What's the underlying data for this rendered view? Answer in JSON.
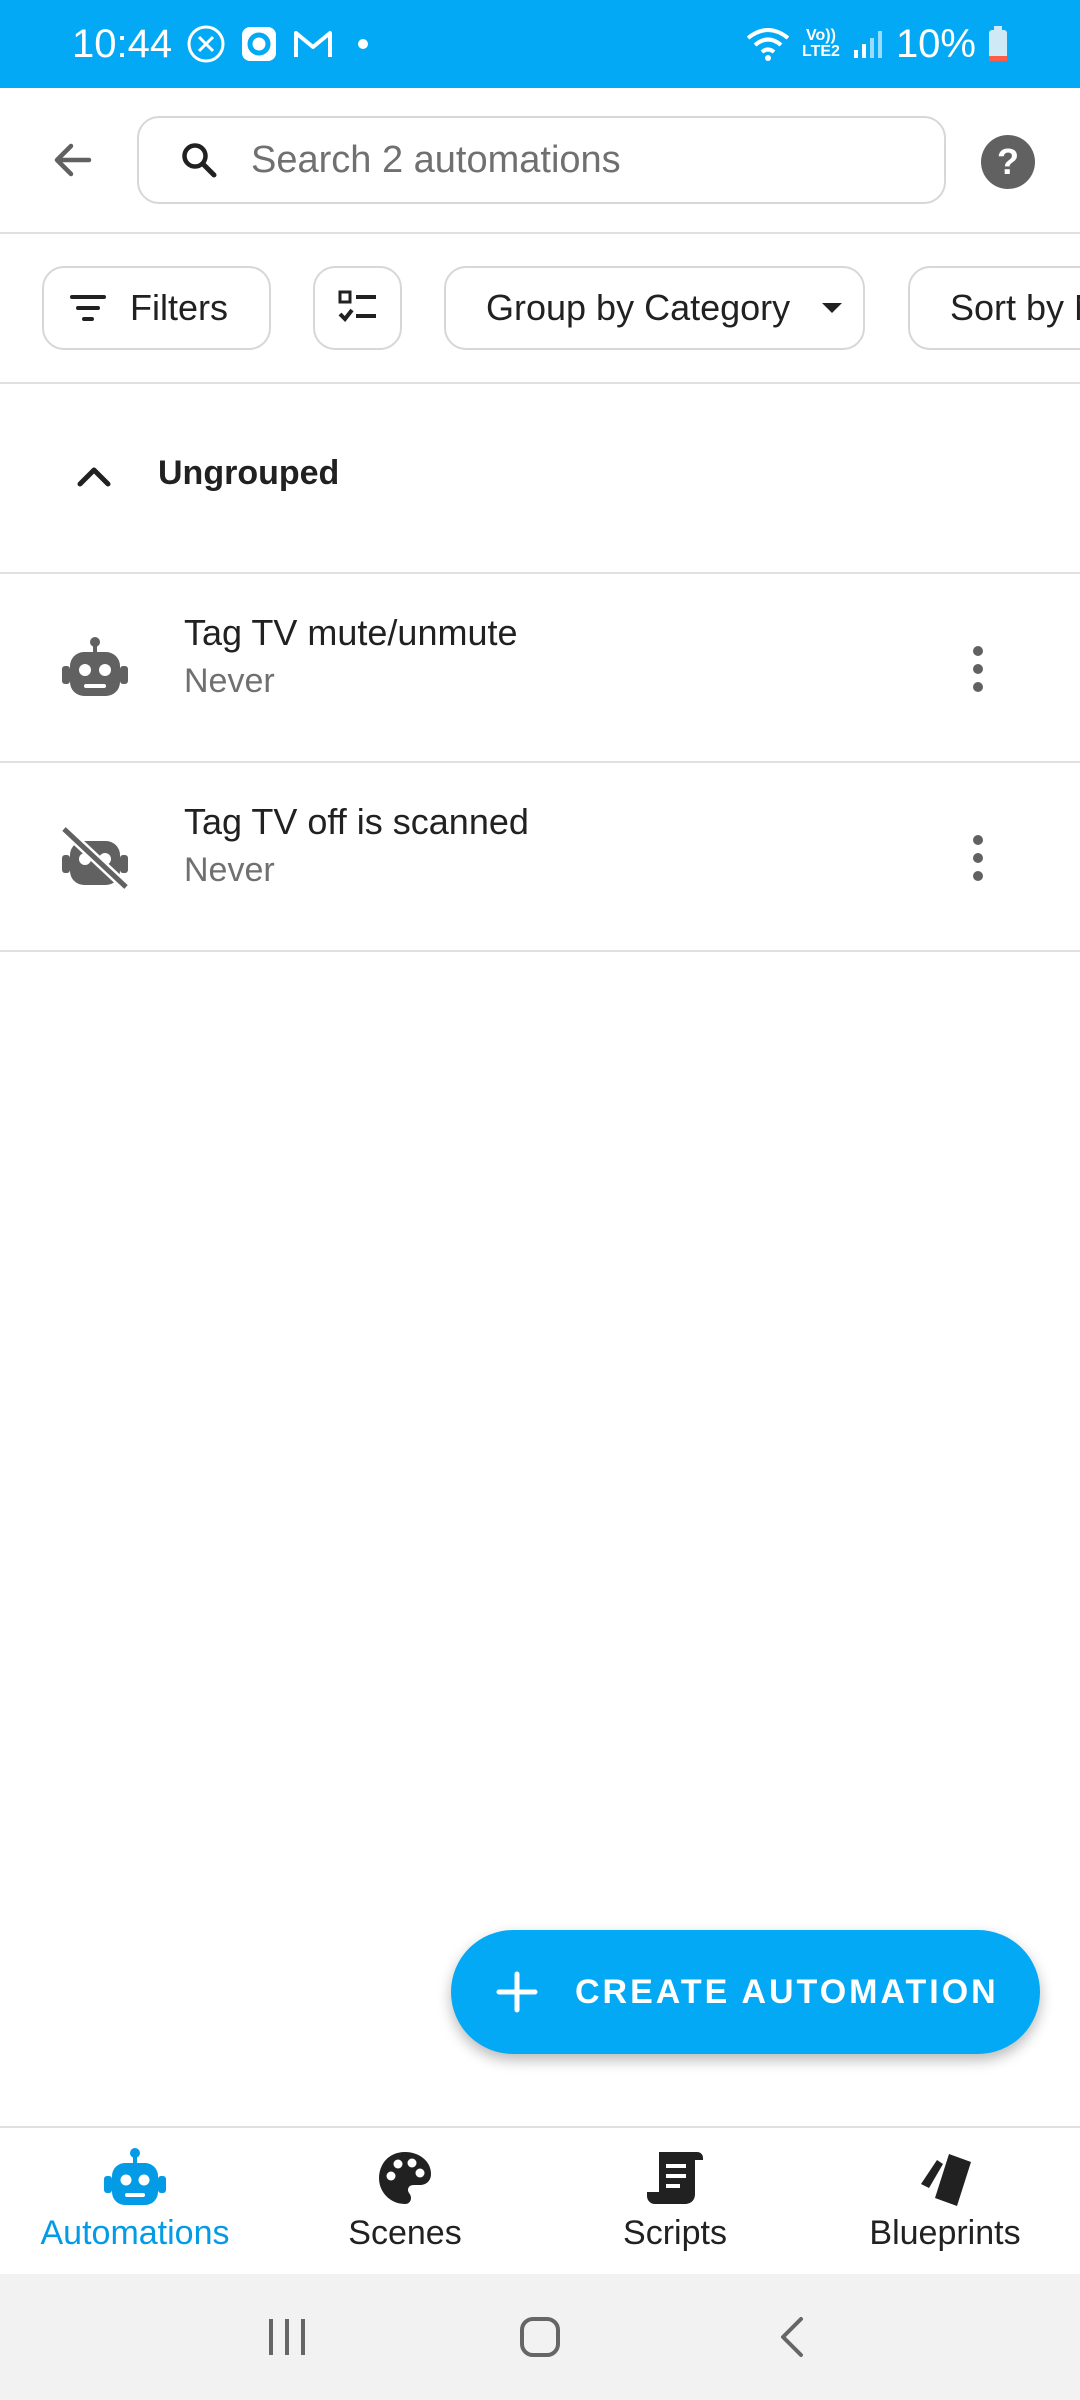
{
  "status_bar": {
    "time": "10:44",
    "network_label": "LTE2",
    "volte_label": "Vo))",
    "battery": "10%"
  },
  "toolbar": {
    "search_placeholder": "Search 2 automations"
  },
  "chips": {
    "filters": "Filters",
    "group_by": "Group by Category",
    "sort_by": "Sort by Name"
  },
  "group": {
    "title": "Ungrouped"
  },
  "automations": [
    {
      "name": "Tag TV mute/unmute",
      "last_triggered": "Never",
      "icon": "robot-icon",
      "enabled": true
    },
    {
      "name": "Tag TV off is scanned",
      "last_triggered": "Never",
      "icon": "robot-off-icon",
      "enabled": false
    }
  ],
  "fab": {
    "label": "CREATE AUTOMATION"
  },
  "bottom_nav": [
    {
      "label": "Automations",
      "icon": "robot-icon",
      "active": true
    },
    {
      "label": "Scenes",
      "icon": "palette-icon",
      "active": false
    },
    {
      "label": "Scripts",
      "icon": "script-icon",
      "active": false
    },
    {
      "label": "Blueprints",
      "icon": "blueprint-icon",
      "active": false
    }
  ],
  "colors": {
    "accent": "#03a9f4",
    "active_nav": "#039be5",
    "text_primary": "#212121",
    "text_secondary": "#707070",
    "divider": "#e0e0e0"
  }
}
